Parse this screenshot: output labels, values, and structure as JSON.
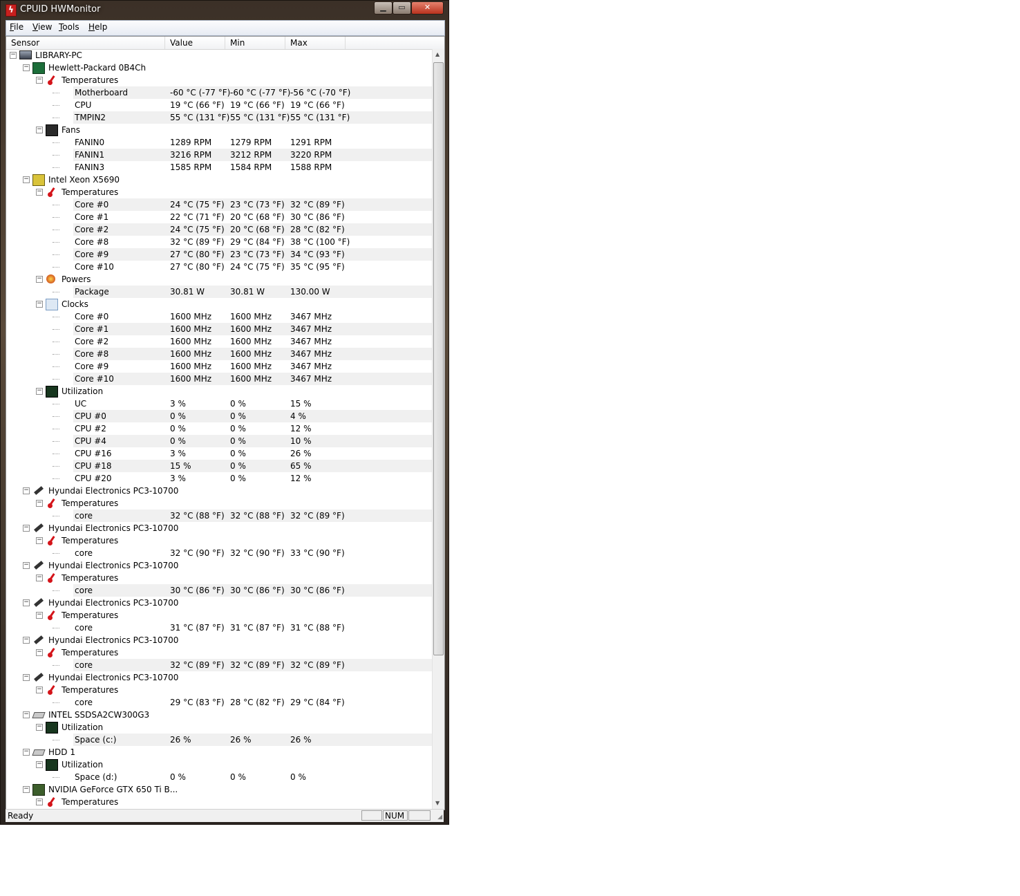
{
  "window": {
    "title": "CPUID HWMonitor"
  },
  "menu": [
    {
      "pre": "",
      "u": "F",
      "post": "ile"
    },
    {
      "pre": "",
      "u": "V",
      "post": "iew"
    },
    {
      "pre": "",
      "u": "T",
      "post": "ools"
    },
    {
      "pre": "",
      "u": "H",
      "post": "elp"
    }
  ],
  "columns": [
    "Sensor",
    "Value",
    "Min",
    "Max"
  ],
  "rows": [
    {
      "level": 0,
      "type": "node",
      "icon": "pc-icon",
      "label": "LIBRARY-PC"
    },
    {
      "level": 1,
      "type": "node",
      "icon": "motherboard-icon",
      "label": "Hewlett-Packard 0B4Ch"
    },
    {
      "level": 2,
      "type": "node",
      "icon": "thermometer-icon",
      "label": "Temperatures"
    },
    {
      "level": 3,
      "type": "leaf",
      "label": "Motherboard",
      "value": "-60 °C  (-77 °F)",
      "min": "-60 °C  (-77 °F)",
      "max": "-56 °C  (-70 °F)"
    },
    {
      "level": 3,
      "type": "leaf",
      "label": "CPU",
      "value": "19 °C  (66 °F)",
      "min": "19 °C  (66 °F)",
      "max": "19 °C  (66 °F)"
    },
    {
      "level": 3,
      "type": "leaf",
      "label": "TMPIN2",
      "value": "55 °C  (131 °F)",
      "min": "55 °C  (131 °F)",
      "max": "55 °C  (131 °F)"
    },
    {
      "level": 2,
      "type": "node",
      "icon": "fan-icon",
      "label": "Fans"
    },
    {
      "level": 3,
      "type": "leaf",
      "label": "FANIN0",
      "value": "1289 RPM",
      "min": "1279 RPM",
      "max": "1291 RPM"
    },
    {
      "level": 3,
      "type": "leaf",
      "label": "FANIN1",
      "value": "3216 RPM",
      "min": "3212 RPM",
      "max": "3220 RPM"
    },
    {
      "level": 3,
      "type": "leaf",
      "label": "FANIN3",
      "value": "1585 RPM",
      "min": "1584 RPM",
      "max": "1588 RPM"
    },
    {
      "level": 1,
      "type": "node",
      "icon": "cpu-icon",
      "label": "Intel Xeon X5690"
    },
    {
      "level": 2,
      "type": "node",
      "icon": "thermometer-icon",
      "label": "Temperatures"
    },
    {
      "level": 3,
      "type": "leaf",
      "label": "Core #0",
      "value": "24 °C  (75 °F)",
      "min": "23 °C  (73 °F)",
      "max": "32 °C  (89 °F)"
    },
    {
      "level": 3,
      "type": "leaf",
      "label": "Core #1",
      "value": "22 °C  (71 °F)",
      "min": "20 °C  (68 °F)",
      "max": "30 °C  (86 °F)"
    },
    {
      "level": 3,
      "type": "leaf",
      "label": "Core #2",
      "value": "24 °C  (75 °F)",
      "min": "20 °C  (68 °F)",
      "max": "28 °C  (82 °F)"
    },
    {
      "level": 3,
      "type": "leaf",
      "label": "Core #8",
      "value": "32 °C  (89 °F)",
      "min": "29 °C  (84 °F)",
      "max": "38 °C  (100 °F)"
    },
    {
      "level": 3,
      "type": "leaf",
      "label": "Core #9",
      "value": "27 °C  (80 °F)",
      "min": "23 °C  (73 °F)",
      "max": "34 °C  (93 °F)"
    },
    {
      "level": 3,
      "type": "leaf",
      "label": "Core #10",
      "value": "27 °C  (80 °F)",
      "min": "24 °C  (75 °F)",
      "max": "35 °C  (95 °F)"
    },
    {
      "level": 2,
      "type": "node",
      "icon": "power-icon",
      "label": "Powers"
    },
    {
      "level": 3,
      "type": "leaf",
      "label": "Package",
      "value": "30.81 W",
      "min": "30.81 W",
      "max": "130.00 W"
    },
    {
      "level": 2,
      "type": "node",
      "icon": "clock-icon",
      "label": "Clocks"
    },
    {
      "level": 3,
      "type": "leaf",
      "label": "Core #0",
      "value": "1600 MHz",
      "min": "1600 MHz",
      "max": "3467 MHz"
    },
    {
      "level": 3,
      "type": "leaf",
      "label": "Core #1",
      "value": "1600 MHz",
      "min": "1600 MHz",
      "max": "3467 MHz"
    },
    {
      "level": 3,
      "type": "leaf",
      "label": "Core #2",
      "value": "1600 MHz",
      "min": "1600 MHz",
      "max": "3467 MHz"
    },
    {
      "level": 3,
      "type": "leaf",
      "label": "Core #8",
      "value": "1600 MHz",
      "min": "1600 MHz",
      "max": "3467 MHz"
    },
    {
      "level": 3,
      "type": "leaf",
      "label": "Core #9",
      "value": "1600 MHz",
      "min": "1600 MHz",
      "max": "3467 MHz"
    },
    {
      "level": 3,
      "type": "leaf",
      "label": "Core #10",
      "value": "1600 MHz",
      "min": "1600 MHz",
      "max": "3467 MHz"
    },
    {
      "level": 2,
      "type": "node",
      "icon": "utilization-icon",
      "label": "Utilization"
    },
    {
      "level": 3,
      "type": "leaf",
      "label": "UC",
      "value": "3 %",
      "min": "0 %",
      "max": "15 %"
    },
    {
      "level": 3,
      "type": "leaf",
      "label": "CPU #0",
      "value": "0 %",
      "min": "0 %",
      "max": "4 %"
    },
    {
      "level": 3,
      "type": "leaf",
      "label": "CPU #2",
      "value": "0 %",
      "min": "0 %",
      "max": "12 %"
    },
    {
      "level": 3,
      "type": "leaf",
      "label": "CPU #4",
      "value": "0 %",
      "min": "0 %",
      "max": "10 %"
    },
    {
      "level": 3,
      "type": "leaf",
      "label": "CPU #16",
      "value": "3 %",
      "min": "0 %",
      "max": "26 %"
    },
    {
      "level": 3,
      "type": "leaf",
      "label": "CPU #18",
      "value": "15 %",
      "min": "0 %",
      "max": "65 %"
    },
    {
      "level": 3,
      "type": "leaf",
      "label": "CPU #20",
      "value": "3 %",
      "min": "0 %",
      "max": "12 %"
    },
    {
      "level": 1,
      "type": "node",
      "icon": "memory-icon",
      "label": "Hyundai Electronics PC3-10700"
    },
    {
      "level": 2,
      "type": "node",
      "icon": "thermometer-icon",
      "label": "Temperatures"
    },
    {
      "level": 3,
      "type": "leaf",
      "label": "core",
      "value": "32 °C  (88 °F)",
      "min": "32 °C  (88 °F)",
      "max": "32 °C  (89 °F)"
    },
    {
      "level": 1,
      "type": "node",
      "icon": "memory-icon",
      "label": "Hyundai Electronics PC3-10700"
    },
    {
      "level": 2,
      "type": "node",
      "icon": "thermometer-icon",
      "label": "Temperatures"
    },
    {
      "level": 3,
      "type": "leaf",
      "label": "core",
      "value": "32 °C  (90 °F)",
      "min": "32 °C  (90 °F)",
      "max": "33 °C  (90 °F)"
    },
    {
      "level": 1,
      "type": "node",
      "icon": "memory-icon",
      "label": "Hyundai Electronics PC3-10700"
    },
    {
      "level": 2,
      "type": "node",
      "icon": "thermometer-icon",
      "label": "Temperatures"
    },
    {
      "level": 3,
      "type": "leaf",
      "label": "core",
      "value": "30 °C  (86 °F)",
      "min": "30 °C  (86 °F)",
      "max": "30 °C  (86 °F)"
    },
    {
      "level": 1,
      "type": "node",
      "icon": "memory-icon",
      "label": "Hyundai Electronics PC3-10700"
    },
    {
      "level": 2,
      "type": "node",
      "icon": "thermometer-icon",
      "label": "Temperatures"
    },
    {
      "level": 3,
      "type": "leaf",
      "label": "core",
      "value": "31 °C  (87 °F)",
      "min": "31 °C  (87 °F)",
      "max": "31 °C  (88 °F)"
    },
    {
      "level": 1,
      "type": "node",
      "icon": "memory-icon",
      "label": "Hyundai Electronics PC3-10700"
    },
    {
      "level": 2,
      "type": "node",
      "icon": "thermometer-icon",
      "label": "Temperatures"
    },
    {
      "level": 3,
      "type": "leaf",
      "label": "core",
      "value": "32 °C  (89 °F)",
      "min": "32 °C  (89 °F)",
      "max": "32 °C  (89 °F)"
    },
    {
      "level": 1,
      "type": "node",
      "icon": "memory-icon",
      "label": "Hyundai Electronics PC3-10700"
    },
    {
      "level": 2,
      "type": "node",
      "icon": "thermometer-icon",
      "label": "Temperatures"
    },
    {
      "level": 3,
      "type": "leaf",
      "label": "core",
      "value": "29 °C  (83 °F)",
      "min": "28 °C  (82 °F)",
      "max": "29 °C  (84 °F)"
    },
    {
      "level": 1,
      "type": "node",
      "icon": "disk-icon",
      "label": "INTEL SSDSA2CW300G3"
    },
    {
      "level": 2,
      "type": "node",
      "icon": "utilization-icon",
      "label": "Utilization"
    },
    {
      "level": 3,
      "type": "leaf",
      "label": "Space (c:)",
      "value": "26 %",
      "min": "26 %",
      "max": "26 %"
    },
    {
      "level": 1,
      "type": "node",
      "icon": "disk-icon",
      "label": "HDD 1"
    },
    {
      "level": 2,
      "type": "node",
      "icon": "utilization-icon",
      "label": "Utilization"
    },
    {
      "level": 3,
      "type": "leaf",
      "label": "Space (d:)",
      "value": "0 %",
      "min": "0 %",
      "max": "0 %"
    },
    {
      "level": 1,
      "type": "node",
      "icon": "gpu-icon",
      "label": "NVIDIA GeForce GTX 650 Ti B..."
    },
    {
      "level": 2,
      "type": "node",
      "icon": "thermometer-icon",
      "label": "Temperatures"
    }
  ],
  "status": {
    "text": "Ready",
    "num": "NUM"
  }
}
